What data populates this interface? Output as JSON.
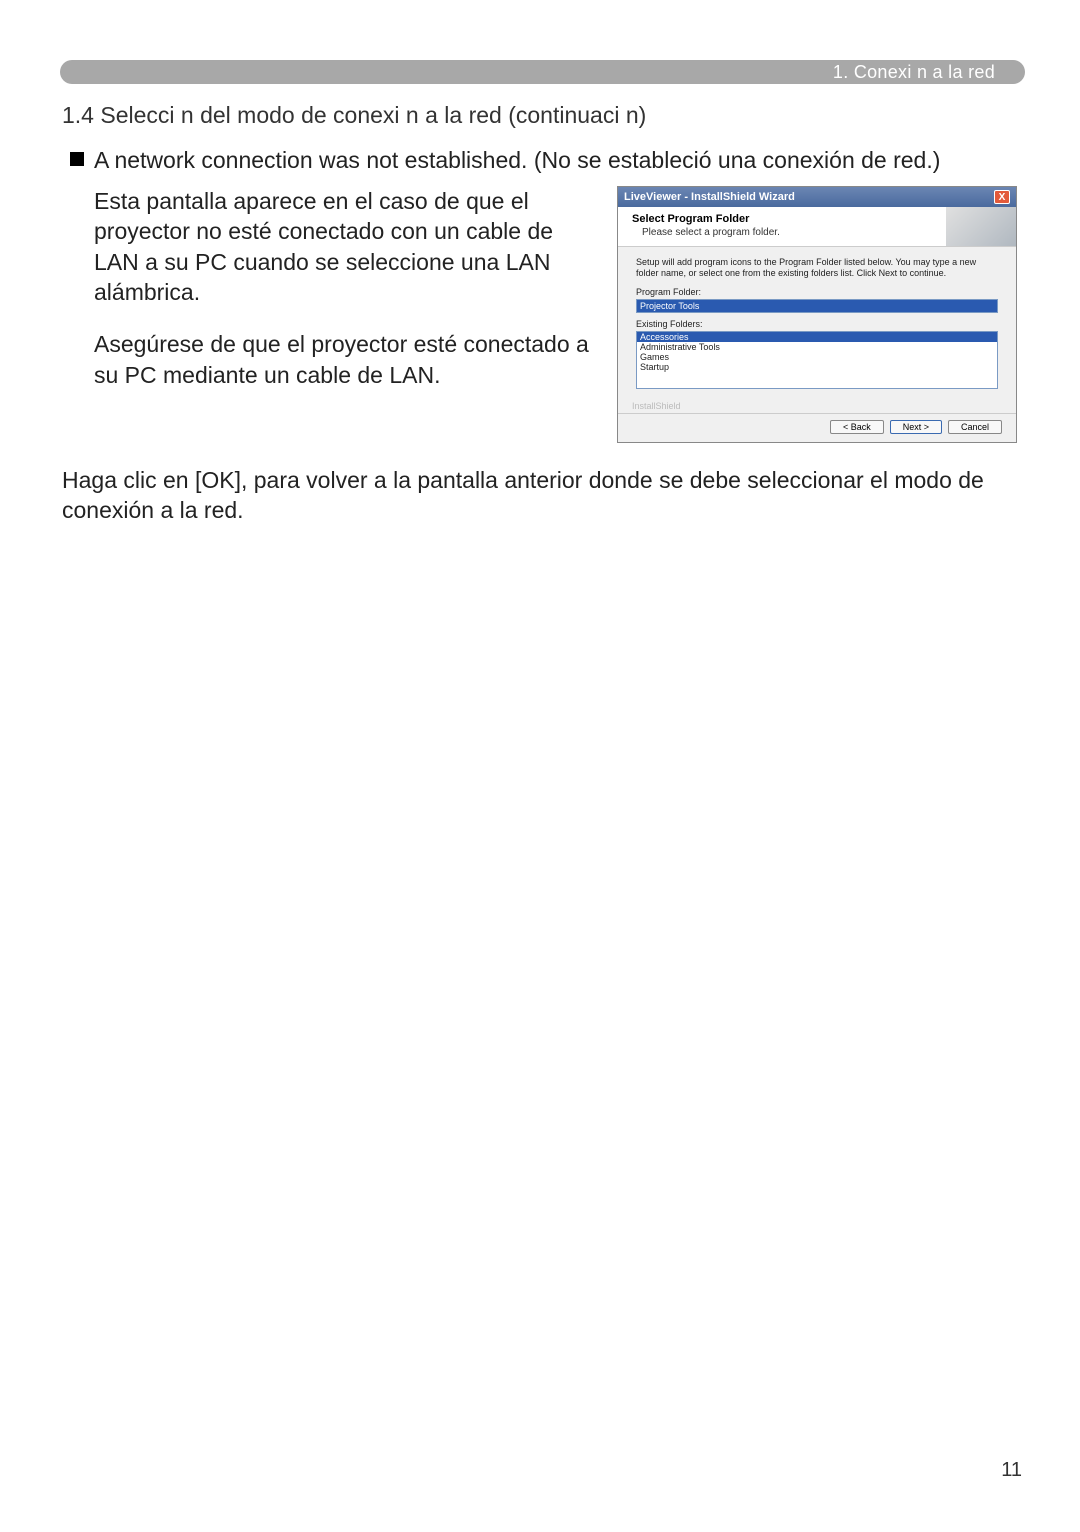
{
  "header": {
    "breadcrumb": "1. Conexi n a la red"
  },
  "section_title": "1.4 Selecci n del modo de conexi n a la red (continuaci n)",
  "bullet": {
    "text": "A network connection was not established. (No se estableció una conexión de red.)"
  },
  "para1": "Esta pantalla aparece en el caso de que el proyector no esté conectado con un cable de LAN a su PC cuando se seleccione una LAN alámbrica.",
  "para2": "Asegúrese de que el proyector esté conectado a su PC mediante un cable de LAN.",
  "para3": "Haga clic en [OK], para volver a la pantalla anterior donde se debe seleccionar el modo de conexión a la red.",
  "wizard": {
    "title": "LiveViewer - InstallShield Wizard",
    "close": "X",
    "header_title": "Select Program Folder",
    "header_sub": "Please select a program folder.",
    "desc": "Setup will add program icons to the Program Folder listed below. You may type a new folder name, or select one from the existing folders list. Click Next to continue.",
    "program_folder_label": "Program Folder:",
    "program_folder_value": "Projector Tools",
    "existing_label": "Existing Folders:",
    "existing": [
      "Accessories",
      "Administrative Tools",
      "Games",
      "Startup"
    ],
    "brand": "InstallShield",
    "btn_back": "< Back",
    "btn_next": "Next >",
    "btn_cancel": "Cancel"
  },
  "page_number": "11"
}
